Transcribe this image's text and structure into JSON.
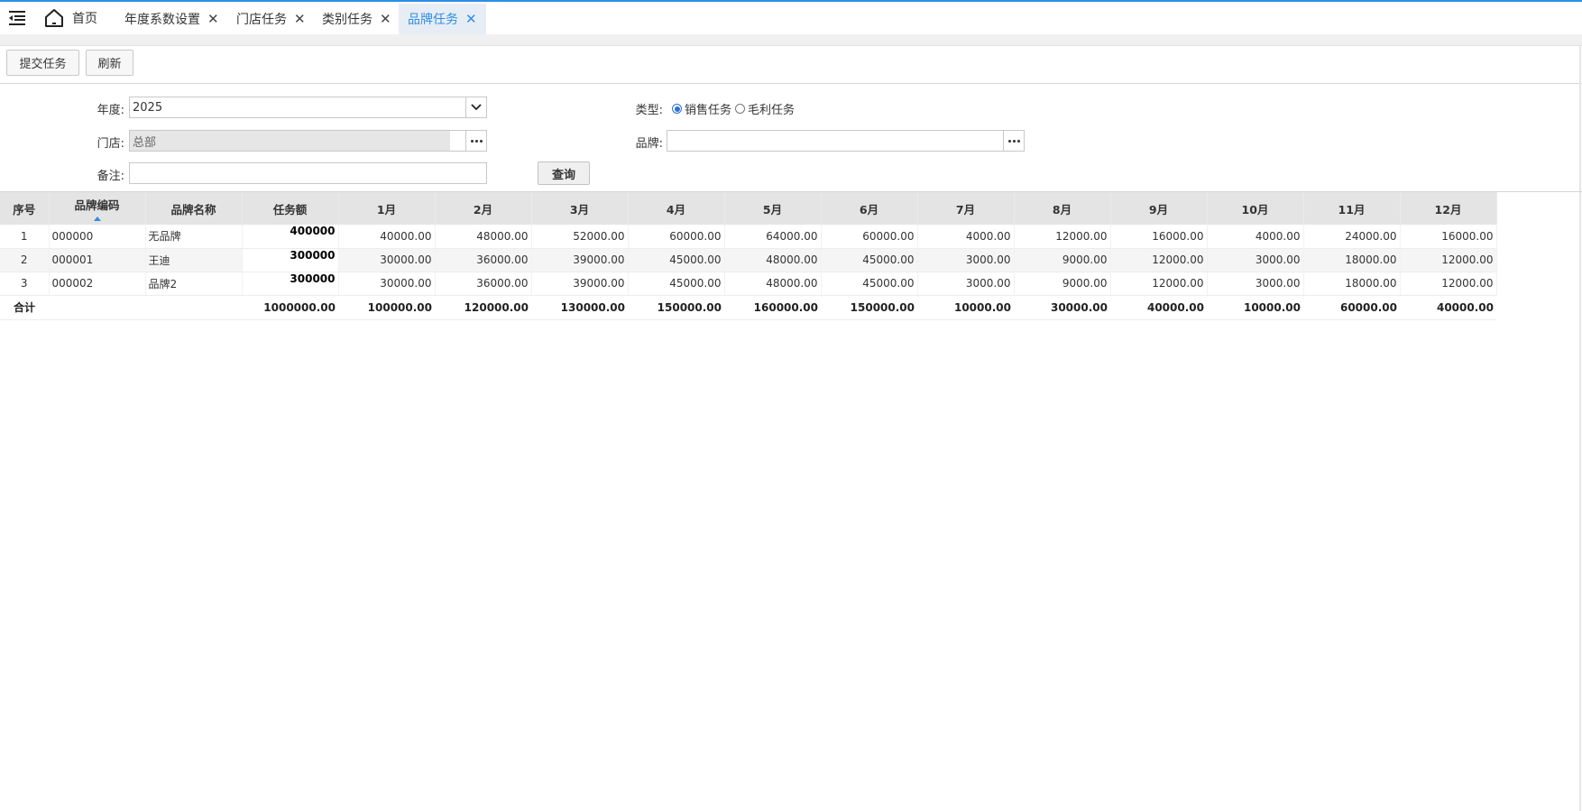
{
  "tabs": {
    "home_label": "首页",
    "items": [
      {
        "label": "年度系数设置",
        "close": "✕"
      },
      {
        "label": "门店任务",
        "close": "✕"
      },
      {
        "label": "类别任务",
        "close": "✕"
      },
      {
        "label": "品牌任务",
        "close": "✕"
      }
    ]
  },
  "toolbar": {
    "submit_label": "提交任务",
    "refresh_label": "刷新"
  },
  "form": {
    "year_label": "年度:",
    "year_value": "2025",
    "store_label": "门店:",
    "store_value": "总部",
    "remark_label": "备注:",
    "remark_value": "",
    "type_label": "类型:",
    "type_options": [
      "销售任务",
      "毛利任务"
    ],
    "type_selected": "销售任务",
    "brand_label": "品牌:",
    "brand_value": "",
    "query_label": "查询"
  },
  "grid": {
    "columns": [
      "序号",
      "品牌编码",
      "品牌名称",
      "任务额",
      "1月",
      "2月",
      "3月",
      "4月",
      "5月",
      "6月",
      "7月",
      "8月",
      "9月",
      "10月",
      "11月",
      "12月"
    ],
    "rows": [
      {
        "seq": "1",
        "code": "000000",
        "name": "无品牌",
        "task": "400000",
        "months": [
          "40000.00",
          "48000.00",
          "52000.00",
          "60000.00",
          "64000.00",
          "60000.00",
          "4000.00",
          "12000.00",
          "16000.00",
          "4000.00",
          "24000.00",
          "16000.00"
        ]
      },
      {
        "seq": "2",
        "code": "000001",
        "name": "王迪",
        "task": "300000",
        "months": [
          "30000.00",
          "36000.00",
          "39000.00",
          "45000.00",
          "48000.00",
          "45000.00",
          "3000.00",
          "9000.00",
          "12000.00",
          "3000.00",
          "18000.00",
          "12000.00"
        ]
      },
      {
        "seq": "3",
        "code": "000002",
        "name": "品牌2",
        "task": "300000",
        "months": [
          "30000.00",
          "36000.00",
          "39000.00",
          "45000.00",
          "48000.00",
          "45000.00",
          "3000.00",
          "9000.00",
          "12000.00",
          "3000.00",
          "18000.00",
          "12000.00"
        ]
      }
    ],
    "total": {
      "label": "合计",
      "task": "1000000.00",
      "months": [
        "100000.00",
        "120000.00",
        "130000.00",
        "150000.00",
        "160000.00",
        "150000.00",
        "10000.00",
        "30000.00",
        "40000.00",
        "10000.00",
        "60000.00",
        "40000.00"
      ]
    }
  },
  "colors": {
    "accent": "#2e8de6",
    "header_bg": "#e4e4e4",
    "active_tab_bg": "#e7edf5"
  }
}
